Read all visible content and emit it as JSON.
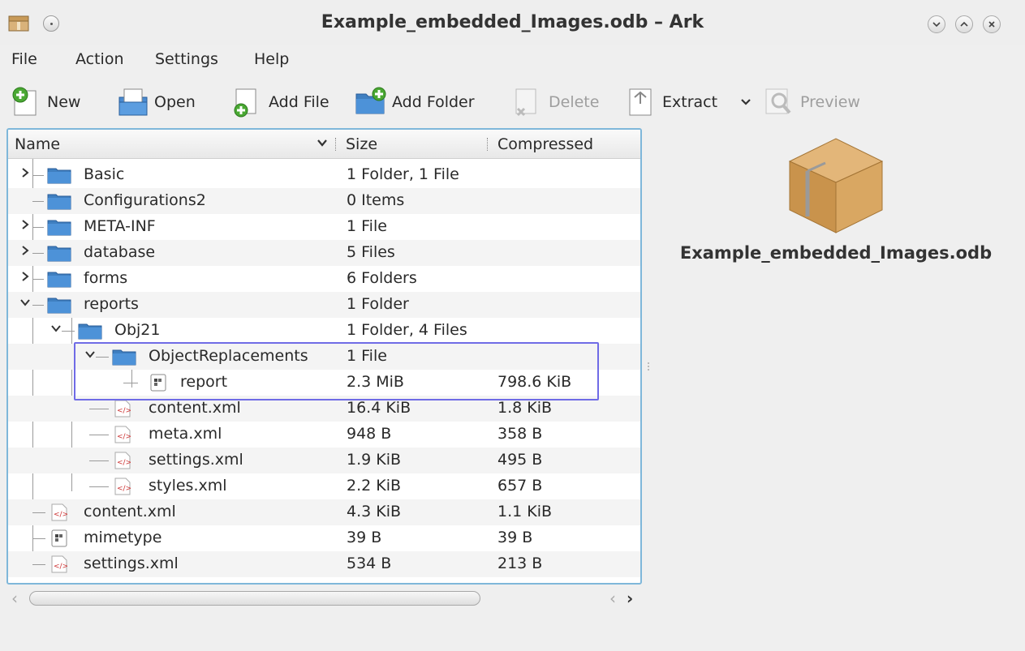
{
  "window": {
    "title": "Example_embedded_Images.odb – Ark"
  },
  "menu": [
    "File",
    "Action",
    "Settings",
    "Help"
  ],
  "toolbar": {
    "new": "New",
    "open": "Open",
    "add_file": "Add File",
    "add_folder": "Add Folder",
    "delete": "Delete",
    "extract": "Extract",
    "preview": "Preview"
  },
  "tree": {
    "headers": {
      "name": "Name",
      "size": "Size",
      "compressed": "Compressed"
    },
    "rows": [
      {
        "name": "Basic",
        "size": "1 Folder, 1 File",
        "compressed": ""
      },
      {
        "name": "Configurations2",
        "size": "0 Items",
        "compressed": ""
      },
      {
        "name": "META-INF",
        "size": "1 File",
        "compressed": ""
      },
      {
        "name": "database",
        "size": "5 Files",
        "compressed": ""
      },
      {
        "name": "forms",
        "size": "6 Folders",
        "compressed": ""
      },
      {
        "name": "reports",
        "size": "1 Folder",
        "compressed": ""
      },
      {
        "name": "Obj21",
        "size": "1 Folder, 4 Files",
        "compressed": ""
      },
      {
        "name": "ObjectReplacements",
        "size": "1 File",
        "compressed": ""
      },
      {
        "name": "report",
        "size": "2.3 MiB",
        "compressed": "798.6 KiB"
      },
      {
        "name": "content.xml",
        "size": "16.4 KiB",
        "compressed": "1.8 KiB"
      },
      {
        "name": "meta.xml",
        "size": "948 B",
        "compressed": "358 B"
      },
      {
        "name": "settings.xml",
        "size": "1.9 KiB",
        "compressed": "495 B"
      },
      {
        "name": "styles.xml",
        "size": "2.2 KiB",
        "compressed": "657 B"
      },
      {
        "name": "content.xml",
        "size": "4.3 KiB",
        "compressed": "1.1 KiB"
      },
      {
        "name": "mimetype",
        "size": "39 B",
        "compressed": "39 B"
      },
      {
        "name": "settings.xml",
        "size": "534 B",
        "compressed": "213 B"
      }
    ]
  },
  "preview": {
    "filename": "Example_embedded_Images.odb",
    "icon": "package-box-icon"
  },
  "colors": {
    "selection_border": "#7fb7da",
    "highlight_box": "#6f6be6",
    "folder_blue": "#3f7fc0"
  }
}
